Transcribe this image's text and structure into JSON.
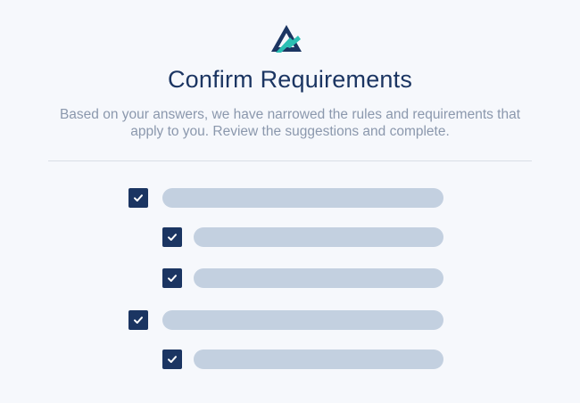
{
  "page": {
    "title": "Confirm Requirements",
    "subtitle": "Based on your answers, we have narrowed the rules and requirements that apply to you. Review the suggestions and complete."
  },
  "logo": {
    "icon": "triangle-logo-icon"
  },
  "requirements": [
    {
      "checked": true,
      "level": 0
    },
    {
      "checked": true,
      "level": 1
    },
    {
      "checked": true,
      "level": 1
    },
    {
      "checked": true,
      "level": 0
    },
    {
      "checked": true,
      "level": 1
    }
  ],
  "colors": {
    "brand_navy": "#1b3562",
    "brand_teal": "#2bbfb3",
    "placeholder_bar": "#c3d0e0",
    "muted_text": "#8b98ad",
    "background": "#f6f8fc"
  }
}
